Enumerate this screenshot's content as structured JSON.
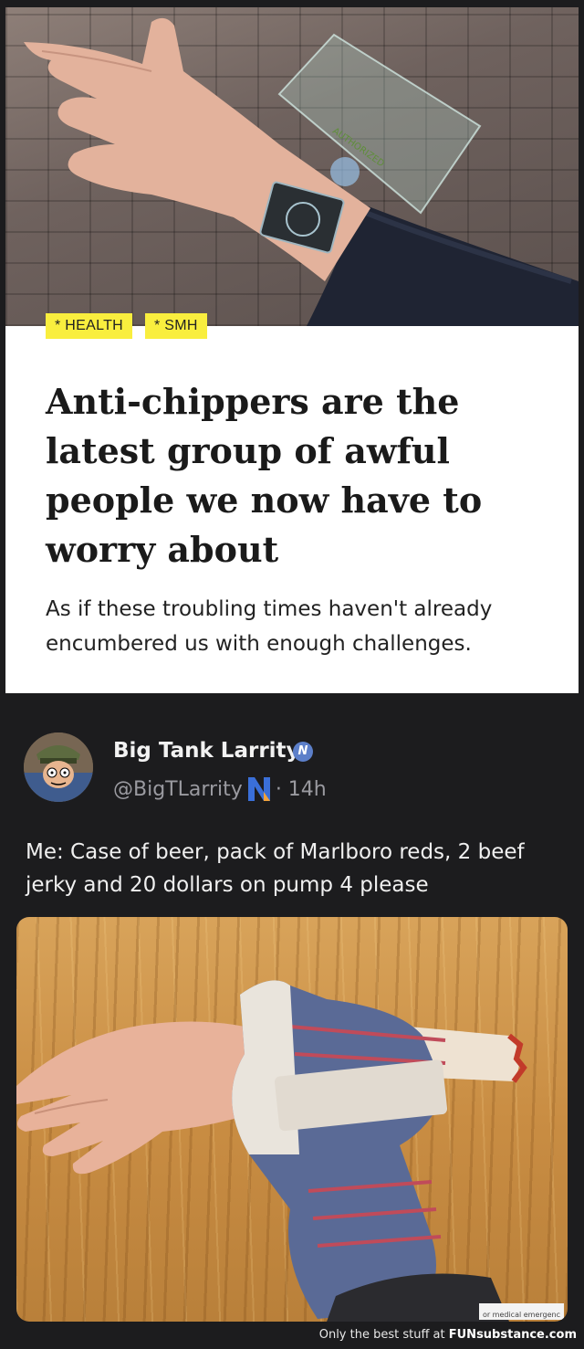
{
  "article": {
    "tags": [
      "* HEALTH",
      "* SMH"
    ],
    "headline": "Anti-chippers are the latest group of awful people we now have to worry about",
    "subhead": "As if these troubling times haven't already encumbered us with enough challenges.",
    "hero_overlay_text": "AUTHORIZED"
  },
  "tweet": {
    "display_name": "Big Tank Larrity",
    "verified_icon": "verified-badge-icon",
    "handle": "@BigTLarrity",
    "time": "· 14h",
    "text": "Me: Case of beer, pack of Marlboro reds, 2 beef jerky and 20 dollars on pump 4 please",
    "photo_caption": "or medical emergenc"
  },
  "footer": {
    "text_prefix": "Only the best stuff at ",
    "brand": "FUNsubstance.com"
  },
  "colors": {
    "tag_yellow": "#f9ee3e",
    "dark_bg": "#1c1c1e",
    "verified_blue": "#5c7fc9"
  }
}
